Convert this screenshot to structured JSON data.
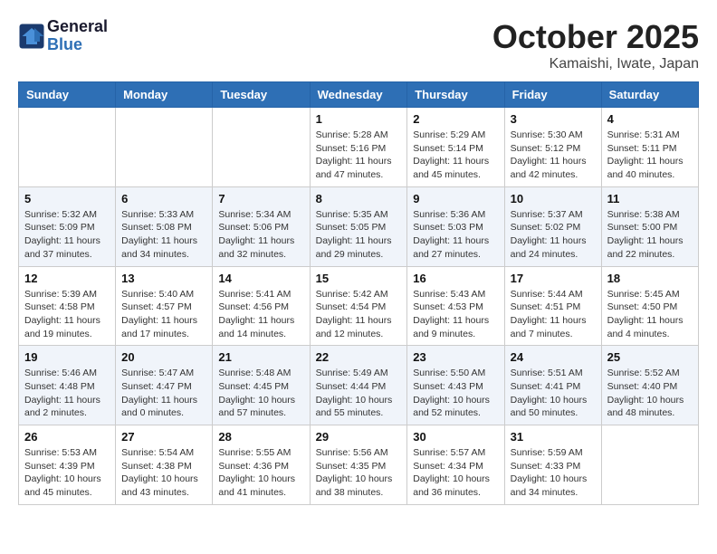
{
  "header": {
    "logo_line1": "General",
    "logo_line2": "Blue",
    "month": "October 2025",
    "location": "Kamaishi, Iwate, Japan"
  },
  "days_of_week": [
    "Sunday",
    "Monday",
    "Tuesday",
    "Wednesday",
    "Thursday",
    "Friday",
    "Saturday"
  ],
  "weeks": [
    [
      {
        "day": "",
        "info": ""
      },
      {
        "day": "",
        "info": ""
      },
      {
        "day": "",
        "info": ""
      },
      {
        "day": "1",
        "info": "Sunrise: 5:28 AM\nSunset: 5:16 PM\nDaylight: 11 hours and 47 minutes."
      },
      {
        "day": "2",
        "info": "Sunrise: 5:29 AM\nSunset: 5:14 PM\nDaylight: 11 hours and 45 minutes."
      },
      {
        "day": "3",
        "info": "Sunrise: 5:30 AM\nSunset: 5:12 PM\nDaylight: 11 hours and 42 minutes."
      },
      {
        "day": "4",
        "info": "Sunrise: 5:31 AM\nSunset: 5:11 PM\nDaylight: 11 hours and 40 minutes."
      }
    ],
    [
      {
        "day": "5",
        "info": "Sunrise: 5:32 AM\nSunset: 5:09 PM\nDaylight: 11 hours and 37 minutes."
      },
      {
        "day": "6",
        "info": "Sunrise: 5:33 AM\nSunset: 5:08 PM\nDaylight: 11 hours and 34 minutes."
      },
      {
        "day": "7",
        "info": "Sunrise: 5:34 AM\nSunset: 5:06 PM\nDaylight: 11 hours and 32 minutes."
      },
      {
        "day": "8",
        "info": "Sunrise: 5:35 AM\nSunset: 5:05 PM\nDaylight: 11 hours and 29 minutes."
      },
      {
        "day": "9",
        "info": "Sunrise: 5:36 AM\nSunset: 5:03 PM\nDaylight: 11 hours and 27 minutes."
      },
      {
        "day": "10",
        "info": "Sunrise: 5:37 AM\nSunset: 5:02 PM\nDaylight: 11 hours and 24 minutes."
      },
      {
        "day": "11",
        "info": "Sunrise: 5:38 AM\nSunset: 5:00 PM\nDaylight: 11 hours and 22 minutes."
      }
    ],
    [
      {
        "day": "12",
        "info": "Sunrise: 5:39 AM\nSunset: 4:58 PM\nDaylight: 11 hours and 19 minutes."
      },
      {
        "day": "13",
        "info": "Sunrise: 5:40 AM\nSunset: 4:57 PM\nDaylight: 11 hours and 17 minutes."
      },
      {
        "day": "14",
        "info": "Sunrise: 5:41 AM\nSunset: 4:56 PM\nDaylight: 11 hours and 14 minutes."
      },
      {
        "day": "15",
        "info": "Sunrise: 5:42 AM\nSunset: 4:54 PM\nDaylight: 11 hours and 12 minutes."
      },
      {
        "day": "16",
        "info": "Sunrise: 5:43 AM\nSunset: 4:53 PM\nDaylight: 11 hours and 9 minutes."
      },
      {
        "day": "17",
        "info": "Sunrise: 5:44 AM\nSunset: 4:51 PM\nDaylight: 11 hours and 7 minutes."
      },
      {
        "day": "18",
        "info": "Sunrise: 5:45 AM\nSunset: 4:50 PM\nDaylight: 11 hours and 4 minutes."
      }
    ],
    [
      {
        "day": "19",
        "info": "Sunrise: 5:46 AM\nSunset: 4:48 PM\nDaylight: 11 hours and 2 minutes."
      },
      {
        "day": "20",
        "info": "Sunrise: 5:47 AM\nSunset: 4:47 PM\nDaylight: 11 hours and 0 minutes."
      },
      {
        "day": "21",
        "info": "Sunrise: 5:48 AM\nSunset: 4:45 PM\nDaylight: 10 hours and 57 minutes."
      },
      {
        "day": "22",
        "info": "Sunrise: 5:49 AM\nSunset: 4:44 PM\nDaylight: 10 hours and 55 minutes."
      },
      {
        "day": "23",
        "info": "Sunrise: 5:50 AM\nSunset: 4:43 PM\nDaylight: 10 hours and 52 minutes."
      },
      {
        "day": "24",
        "info": "Sunrise: 5:51 AM\nSunset: 4:41 PM\nDaylight: 10 hours and 50 minutes."
      },
      {
        "day": "25",
        "info": "Sunrise: 5:52 AM\nSunset: 4:40 PM\nDaylight: 10 hours and 48 minutes."
      }
    ],
    [
      {
        "day": "26",
        "info": "Sunrise: 5:53 AM\nSunset: 4:39 PM\nDaylight: 10 hours and 45 minutes."
      },
      {
        "day": "27",
        "info": "Sunrise: 5:54 AM\nSunset: 4:38 PM\nDaylight: 10 hours and 43 minutes."
      },
      {
        "day": "28",
        "info": "Sunrise: 5:55 AM\nSunset: 4:36 PM\nDaylight: 10 hours and 41 minutes."
      },
      {
        "day": "29",
        "info": "Sunrise: 5:56 AM\nSunset: 4:35 PM\nDaylight: 10 hours and 38 minutes."
      },
      {
        "day": "30",
        "info": "Sunrise: 5:57 AM\nSunset: 4:34 PM\nDaylight: 10 hours and 36 minutes."
      },
      {
        "day": "31",
        "info": "Sunrise: 5:59 AM\nSunset: 4:33 PM\nDaylight: 10 hours and 34 minutes."
      },
      {
        "day": "",
        "info": ""
      }
    ]
  ]
}
